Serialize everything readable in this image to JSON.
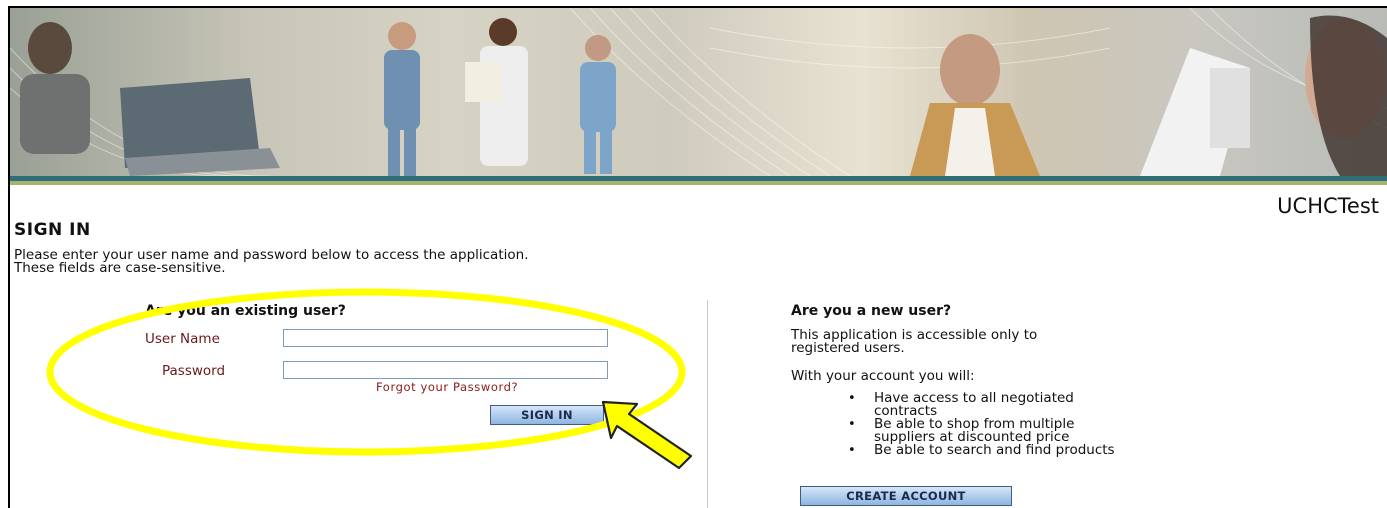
{
  "header": {
    "tenant_name": "UCHCTest",
    "banner_image": "medical-staff-collage-banner"
  },
  "signin": {
    "title": "SIGN IN",
    "intro_line1": "Please enter your user name and password below to access the application.",
    "intro_line2": "These fields are case-sensitive."
  },
  "existing_user": {
    "heading": "Are you an existing user?",
    "username_label": "User Name",
    "username_value": "",
    "password_label": "Password",
    "password_value": "",
    "forgot_link": "Forgot your Password?",
    "signin_button": "SIGN IN"
  },
  "new_user": {
    "heading": "Are you a new user?",
    "desc_line1": "This application is accessible only to",
    "desc_line2": "registered users.",
    "benefits_intro": "With your account you will:",
    "benefits": [
      {
        "line1": "Have access to all negotiated",
        "line2": "contracts"
      },
      {
        "line1": "Be able to shop from multiple",
        "line2": "suppliers at discounted price"
      },
      {
        "line1": "Be able to search and find products",
        "line2": ""
      }
    ],
    "create_button": "CREATE ACCOUNT"
  },
  "annotations": {
    "highlight_color": "#ffff00",
    "arrow_color": "#ffff00"
  }
}
